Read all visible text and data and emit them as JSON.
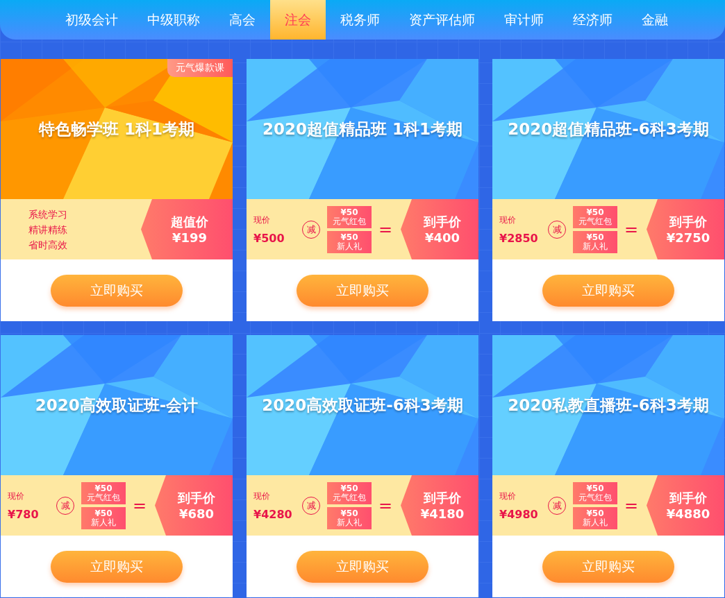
{
  "nav": [
    {
      "label": "初级会计",
      "selected": false
    },
    {
      "label": "中级职称",
      "selected": false
    },
    {
      "label": "高会",
      "selected": false
    },
    {
      "label": "注会",
      "selected": true
    },
    {
      "label": "税务师",
      "selected": false
    },
    {
      "label": "资产评估师",
      "selected": false
    },
    {
      "label": "审计师",
      "selected": false
    },
    {
      "label": "经济师",
      "selected": false
    },
    {
      "label": "金融",
      "selected": false
    }
  ],
  "courses": [
    {
      "kind": "feature",
      "title": "特色畅学班 1科1考期",
      "badge": "元气爆款课",
      "features": [
        "系统学习",
        "精讲精练",
        "省时高效"
      ],
      "deal_label": "超值价",
      "deal_price": "¥199",
      "button": "立即购买"
    },
    {
      "kind": "discount",
      "title": "2020超值精品班 1科1考期",
      "price_label": "现价",
      "price": "¥500",
      "minus": "减",
      "coupons": [
        {
          "amount": "¥50",
          "name": "元气红包"
        },
        {
          "amount": "¥50",
          "name": "新人礼"
        }
      ],
      "equals": "=",
      "deal_label": "到手价",
      "deal_price": "¥400",
      "button": "立即购买"
    },
    {
      "kind": "discount",
      "title": "2020超值精品班-6科3考期",
      "price_label": "现价",
      "price": "¥2850",
      "minus": "减",
      "coupons": [
        {
          "amount": "¥50",
          "name": "元气红包"
        },
        {
          "amount": "¥50",
          "name": "新人礼"
        }
      ],
      "equals": "=",
      "deal_label": "到手价",
      "deal_price": "¥2750",
      "button": "立即购买"
    },
    {
      "kind": "discount",
      "title": "2020高效取证班-会计",
      "price_label": "现价",
      "price": "¥780",
      "minus": "减",
      "coupons": [
        {
          "amount": "¥50",
          "name": "元气红包"
        },
        {
          "amount": "¥50",
          "name": "新人礼"
        }
      ],
      "equals": "=",
      "deal_label": "到手价",
      "deal_price": "¥680",
      "button": "立即购买"
    },
    {
      "kind": "discount",
      "title": "2020高效取证班-6科3考期",
      "price_label": "现价",
      "price": "¥4280",
      "minus": "减",
      "coupons": [
        {
          "amount": "¥50",
          "name": "元气红包"
        },
        {
          "amount": "¥50",
          "name": "新人礼"
        }
      ],
      "equals": "=",
      "deal_label": "到手价",
      "deal_price": "¥4180",
      "button": "立即购买"
    },
    {
      "kind": "discount",
      "title": "2020私教直播班-6科3考期",
      "price_label": "现价",
      "price": "¥4980",
      "minus": "减",
      "coupons": [
        {
          "amount": "¥50",
          "name": "元气红包"
        },
        {
          "amount": "¥50",
          "name": "新人礼"
        }
      ],
      "equals": "=",
      "deal_label": "到手价",
      "deal_price": "¥4880",
      "button": "立即购买"
    }
  ]
}
